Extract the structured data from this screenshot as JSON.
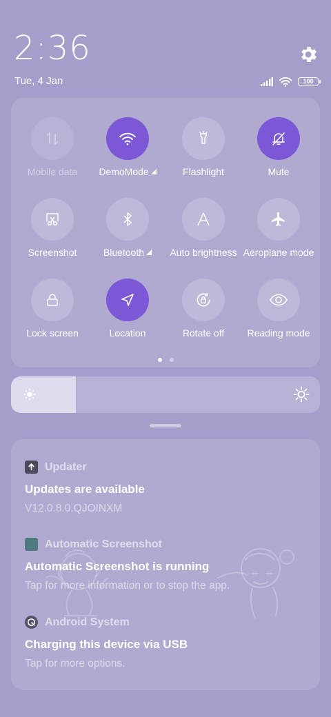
{
  "status": {
    "time": "2:36",
    "date": "Tue, 4 Jan",
    "battery": "100",
    "icons": [
      "signal-icon",
      "wifi-icon",
      "battery-icon"
    ]
  },
  "settings_icon": "gear-icon",
  "quick_settings": {
    "tiles": [
      {
        "label": "Mobile data",
        "icon": "mobile-data-icon",
        "state": "disabled"
      },
      {
        "label": "DemoMode",
        "icon": "wifi-icon",
        "state": "active",
        "has_arrow": true
      },
      {
        "label": "Flashlight",
        "icon": "flashlight-icon",
        "state": "inactive"
      },
      {
        "label": "Mute",
        "icon": "bell-off-icon",
        "state": "active"
      },
      {
        "label": "Screenshot",
        "icon": "screenshot-icon",
        "state": "inactive"
      },
      {
        "label": "Bluetooth",
        "icon": "bluetooth-icon",
        "state": "inactive",
        "has_arrow": true
      },
      {
        "label": "Auto brightness",
        "icon": "auto-brightness-icon",
        "state": "inactive"
      },
      {
        "label": "Aeroplane mode",
        "icon": "airplane-icon",
        "state": "inactive"
      },
      {
        "label": "Lock screen",
        "icon": "lock-icon",
        "state": "inactive"
      },
      {
        "label": "Location",
        "icon": "location-icon",
        "state": "active"
      },
      {
        "label": "Rotate off",
        "icon": "rotate-lock-icon",
        "state": "inactive"
      },
      {
        "label": "Reading mode",
        "icon": "eye-icon",
        "state": "inactive"
      }
    ],
    "page_count": 2,
    "current_page": 1
  },
  "brightness": {
    "level_fraction": 0.21
  },
  "colors": {
    "background": "#a59ecb",
    "accent": "#7a58d6"
  },
  "notifications": [
    {
      "app": "Updater",
      "icon": "updater-icon",
      "title": "Updates are available",
      "body": "V12.0.8.0.QJOINXM"
    },
    {
      "app": "Automatic Screenshot",
      "icon": "automatic-screenshot-icon",
      "title": "Automatic Screenshot is running",
      "body": "Tap for more information or to stop the app."
    },
    {
      "app": "Android System",
      "icon": "android-system-icon",
      "title": "Charging this device via USB",
      "body": "Tap for more options."
    }
  ]
}
